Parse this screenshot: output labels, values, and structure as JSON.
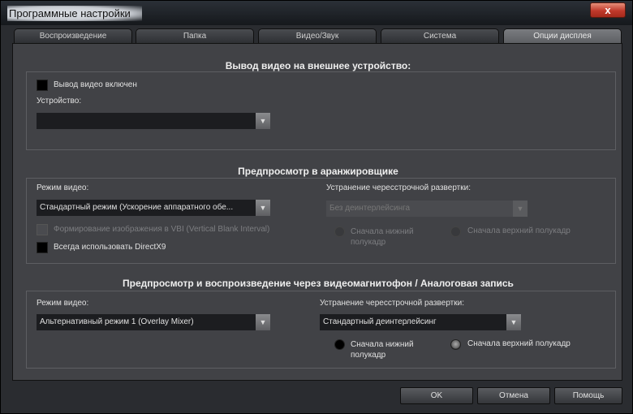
{
  "window": {
    "title": "Программные настройки",
    "close": "x"
  },
  "tabs": [
    "Воспроизведение",
    "Папка",
    "Видео/Звук",
    "Система",
    "Опции дисплея"
  ],
  "active_tab": "Опции дисплея",
  "section1": {
    "heading": "Вывод видео на внешнее устройство:",
    "enable_label": "Вывод видео включен",
    "enable_checked": false,
    "device_label": "Устройство:",
    "device_value": ""
  },
  "section2": {
    "heading": "Предпросмотр в аранжировщике",
    "mode_label": "Режим видео:",
    "mode_value": "Стандартный режим (Ускорение аппаратного обе...",
    "vbi_label": "Формирование изображения в VBI (Vertical Blank Interval)",
    "directx_label": "Всегда использовать DirectX9",
    "deint_label": "Устранение чересстрочной развертки:",
    "deint_value": "Без деинтерлейсинга",
    "lower_label": [
      "Сначала нижний",
      "полукадр"
    ],
    "upper_label": "Сначала верхний полукадр"
  },
  "section3": {
    "heading": "Предпросмотр и воспроизведение через видеомагнитофон / Аналоговая запись",
    "mode_label": "Режим видео:",
    "mode_value": "Альтернативный режим 1 (Overlay Mixer)",
    "deint_label": "Устранение чересстрочной развертки:",
    "deint_value": "Стандартный деинтерлейсинг",
    "lower_label": [
      "Сначала нижний",
      "полукадр"
    ],
    "upper_label": "Сначала верхний полукадр",
    "selected_field": "upper"
  },
  "buttons": {
    "ok": "OK",
    "cancel": "Отмена",
    "help": "Помощь"
  },
  "icons": {
    "dropdown": "▼"
  }
}
